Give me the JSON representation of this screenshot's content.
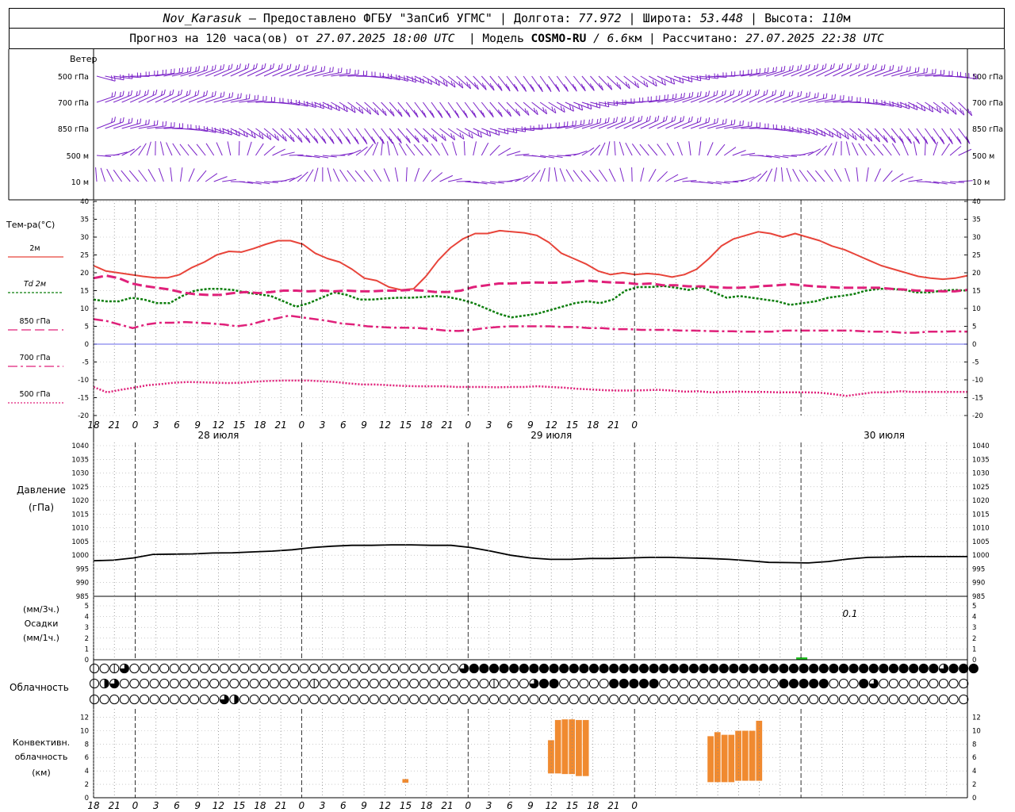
{
  "header": {
    "station": "Nov_Karasuk",
    "provider": " – Предоставлено ФГБУ \"ЗапСиб УГМС\" | ",
    "lon_label": "Долгота: ",
    "lon": "77.972",
    "lat_label": " | Широта: ",
    "lat": "53.448",
    "alt_label": " | Высота: ",
    "alt": "110",
    "alt_unit": "м",
    "forecast_prefix": "Прогноз на 120 часа(ов) от ",
    "forecast_start": "27.07.2025 18:00 UTC",
    "model_prefix": "  | Модель ",
    "model_name": "COSMO-RU",
    "model_res": " / 6.6",
    "model_res_unit": "км",
    "computed_prefix": " | Рассчитано: ",
    "computed_time": "27.07.2025 22:38 UTC"
  },
  "labels": {
    "wind_title": "Ветер",
    "wind_levels": [
      "500 гПа",
      "700 гПа",
      "850 гПа",
      "500 м",
      "10  м"
    ],
    "temp_title": "Тем-ра(°C)",
    "temp_legend": [
      "2м",
      "Td  2м",
      "850 гПа",
      "700 гПа",
      "500 гПа"
    ],
    "pressure_title": "Давление",
    "pressure_unit": "(гПа)",
    "precip_l1": "(мм/3ч.)",
    "precip_l2": "Осадки",
    "precip_l3": "(мм/1ч.)",
    "precip_note": "0.1",
    "cloud_title": "Облачность",
    "conv_l1": "Конвективн.",
    "conv_l2": "облачность",
    "conv_l3": "(км)",
    "hour_ticks": [
      "18",
      "21",
      "0",
      "3",
      "6",
      "9",
      "12",
      "15",
      "18",
      "21",
      "0",
      "3",
      "6",
      "9",
      "12",
      "15",
      "18",
      "21",
      "0",
      "3",
      "6",
      "9",
      "12",
      "15",
      "18",
      "21",
      "0"
    ],
    "day_labels": [
      "28 июля",
      "29 июля",
      "30 июля"
    ]
  },
  "colors": {
    "wind": "#7a22c8",
    "t2m": "#e8443a",
    "td2m": "#0a7d0a",
    "t850": "#e0207a",
    "t700": "#e0207a",
    "t500": "#e0207a",
    "pressure": "#000000",
    "precip": "#22c022",
    "conv": "#f08a30",
    "zero_line": "#3030e0"
  },
  "chart_data": [
    {
      "type": "line",
      "name": "temperature",
      "x_hours_from_start": [
        0,
        1,
        2,
        3,
        4,
        5,
        6,
        7,
        8,
        9,
        10,
        11,
        12,
        13,
        14,
        15,
        16,
        17,
        18,
        19,
        20,
        21,
        22,
        23,
        24,
        25,
        26,
        27,
        28,
        29,
        30,
        31,
        32,
        33,
        34,
        35,
        36,
        37,
        38,
        39,
        40,
        41,
        42,
        43,
        44,
        45,
        46,
        47,
        48,
        49,
        50,
        51,
        52,
        53,
        54,
        55,
        56,
        57,
        58,
        59,
        60,
        61,
        62,
        63,
        64,
        65,
        66,
        67,
        68,
        69,
        70,
        71,
        72,
        73,
        74,
        75,
        76,
        77,
        78
      ],
      "ylim": [
        -20,
        40
      ],
      "yticks": [
        -20,
        -15,
        -10,
        -5,
        0,
        5,
        10,
        15,
        20,
        25,
        30,
        35,
        40
      ],
      "series": [
        {
          "name": "2м",
          "key": "t2m",
          "values": [
            22,
            20.5,
            20,
            19.5,
            19,
            18.6,
            18.6,
            19.5,
            21.5,
            23,
            25,
            26,
            25.8,
            26.8,
            28,
            29,
            29,
            28,
            25.5,
            24,
            23,
            21,
            18.5,
            17.8,
            16,
            15.2,
            15.5,
            19,
            23.5,
            27,
            29.5,
            31,
            31,
            31.8,
            31.5,
            31.2,
            30.5,
            28.5,
            25.5,
            24,
            22.5,
            20.5,
            19.5,
            20,
            19.5,
            19.8,
            19.5,
            18.8,
            19.5,
            21,
            24,
            27.5,
            29.5,
            30.5,
            31.5,
            31,
            30,
            31,
            30,
            29,
            27.5,
            26.5,
            25,
            23.5,
            22,
            21,
            20,
            19,
            18.5,
            18.2,
            18.5,
            19.2
          ]
        },
        {
          "name": "Td 2м",
          "key": "td2m",
          "values": [
            12.5,
            12,
            12,
            13,
            12.5,
            11.5,
            11.5,
            13.5,
            15,
            15.5,
            15.5,
            15.2,
            14.5,
            14,
            13.5,
            12,
            10.5,
            11.5,
            13,
            14.5,
            13.8,
            12.5,
            12.5,
            12.8,
            13,
            13,
            13.2,
            13.5,
            13.2,
            12.5,
            11.5,
            10,
            8.5,
            7.5,
            8,
            8.5,
            9.5,
            10.5,
            11.5,
            12,
            11.5,
            12.5,
            15,
            16,
            16,
            16.3,
            15.8,
            15.2,
            16,
            14.5,
            13,
            13.5,
            13,
            12.5,
            12,
            11,
            11.5,
            12,
            13,
            13.5,
            14,
            15,
            15.5,
            15.5,
            15.2,
            14.5,
            14.5,
            15,
            15.2,
            15
          ]
        },
        {
          "name": "850 гПа",
          "key": "t850",
          "values": [
            18.5,
            19.2,
            18.5,
            17,
            16.3,
            15.8,
            15.3,
            14.5,
            14,
            13.8,
            13.8,
            14.3,
            14.6,
            14.3,
            14.6,
            15,
            15,
            14.8,
            15,
            14.8,
            15,
            14.8,
            14.8,
            15,
            15,
            15.2,
            15,
            14.6,
            14.6,
            15,
            16,
            16.5,
            17,
            17,
            17.2,
            17.3,
            17.2,
            17.3,
            17.5,
            17.8,
            17.5,
            17.3,
            17.2,
            16.8,
            17,
            16.5,
            16.5,
            16.2,
            16.2,
            16,
            15.8,
            15.8,
            16,
            16.3,
            16.5,
            16.8,
            16.5,
            16.2,
            16,
            15.8,
            15.8,
            15.8,
            15.8,
            15.5,
            15.3,
            15,
            15,
            14.8,
            14.8,
            15.2
          ]
        },
        {
          "name": "700 гПа",
          "key": "t700",
          "values": [
            7,
            6.5,
            5.5,
            4.5,
            5.5,
            6,
            6,
            6.2,
            6,
            5.8,
            5.5,
            5,
            5.5,
            6.5,
            7.2,
            8,
            7.5,
            7,
            6.5,
            5.8,
            5.5,
            5,
            4.8,
            4.6,
            4.6,
            4.5,
            4.2,
            3.8,
            3.7,
            4,
            4.5,
            4.8,
            5,
            5,
            5,
            5,
            4.8,
            4.8,
            4.5,
            4.5,
            4.2,
            4.2,
            4,
            4,
            4,
            3.8,
            3.8,
            3.7,
            3.6,
            3.6,
            3.5,
            3.5,
            3.5,
            3.8,
            3.8,
            3.8,
            3.8,
            3.8,
            3.8,
            3.6,
            3.5,
            3.5,
            3.2,
            3.2,
            3.5,
            3.5,
            3.6,
            3.5
          ]
        },
        {
          "name": "500 гПа",
          "key": "t500",
          "values": [
            -12,
            -13.5,
            -12.8,
            -12.2,
            -11.5,
            -11.2,
            -10.8,
            -10.6,
            -10.7,
            -10.8,
            -10.9,
            -10.8,
            -10.5,
            -10.3,
            -10.2,
            -10.2,
            -10.2,
            -10.4,
            -10.6,
            -11,
            -11.3,
            -11.3,
            -11.5,
            -11.7,
            -11.8,
            -11.8,
            -11.8,
            -12,
            -12,
            -12,
            -12.1,
            -12,
            -12,
            -11.8,
            -12,
            -12.2,
            -12.5,
            -12.7,
            -12.9,
            -13,
            -13,
            -12.9,
            -12.8,
            -13,
            -13.3,
            -13.2,
            -13.5,
            -13.4,
            -13.3,
            -13.4,
            -13.4,
            -13.5,
            -13.5,
            -13.5,
            -13.6,
            -14,
            -14.5,
            -14,
            -13.5,
            -13.5,
            -13.2,
            -13.4,
            -13.4,
            -13.4,
            -13.4,
            -13.4
          ]
        }
      ]
    },
    {
      "type": "line",
      "name": "pressure",
      "ylim": [
        985,
        1040
      ],
      "yticks": [
        985,
        990,
        995,
        1000,
        1005,
        1010,
        1015,
        1020,
        1025,
        1030,
        1035,
        1040
      ],
      "values": [
        998,
        998.2,
        999,
        1000.3,
        1000.4,
        1000.5,
        1000.8,
        1000.9,
        1001.2,
        1001.5,
        1002,
        1002.8,
        1003.3,
        1003.6,
        1003.6,
        1003.8,
        1003.8,
        1003.6,
        1003.6,
        1002.8,
        1001.5,
        1000,
        999,
        998.5,
        998.5,
        998.8,
        998.8,
        999,
        999.2,
        999.2,
        999,
        998.8,
        998.5,
        998,
        997.4,
        997.3,
        997.2,
        997.7,
        998.6,
        999.2,
        999.3,
        999.5,
        999.5,
        999.5,
        999.5
      ]
    },
    {
      "type": "bar",
      "name": "precipitation",
      "ylim": [
        0,
        5
      ],
      "yticks": [
        0,
        1,
        2,
        3,
        4,
        5
      ],
      "x_hours_from_start": [
        102
      ],
      "values": [
        0.1
      ]
    },
    {
      "type": "bar",
      "name": "convective cloud",
      "ylim": [
        0,
        13
      ],
      "yticks": [
        0,
        2,
        4,
        6,
        8,
        10,
        12
      ],
      "bars": [
        {
          "x": 45,
          "bottom": 2.2,
          "top": 2.8
        },
        {
          "x": 66,
          "bottom": 3.6,
          "top": 8.6
        },
        {
          "x": 67,
          "bottom": 3.6,
          "top": 11.6
        },
        {
          "x": 68,
          "bottom": 3.5,
          "top": 11.7
        },
        {
          "x": 69,
          "bottom": 3.5,
          "top": 11.7
        },
        {
          "x": 70,
          "bottom": 3.2,
          "top": 11.6
        },
        {
          "x": 71,
          "bottom": 3.2,
          "top": 11.6
        },
        {
          "x": 89,
          "bottom": 2.3,
          "top": 9.2
        },
        {
          "x": 90,
          "bottom": 2.3,
          "top": 9.8
        },
        {
          "x": 91,
          "bottom": 2.3,
          "top": 9.4
        },
        {
          "x": 92,
          "bottom": 2.3,
          "top": 9.4
        },
        {
          "x": 93,
          "bottom": 2.5,
          "top": 10
        },
        {
          "x": 94,
          "bottom": 2.5,
          "top": 10
        },
        {
          "x": 95,
          "bottom": 2.5,
          "top": 10
        },
        {
          "x": 96,
          "bottom": 2.5,
          "top": 11.5
        }
      ]
    }
  ],
  "clouds": {
    "row1": "00130000000000000000000000000000000003444444444444444444444444444444444444444444444443444",
    "row2": "0230000000000000000000100000000000000000100034400000444440000000000004444400043000000000",
    "row3": "0000000000000320000000000000000000000000000000000000000000000000000000000000000000000000"
  }
}
